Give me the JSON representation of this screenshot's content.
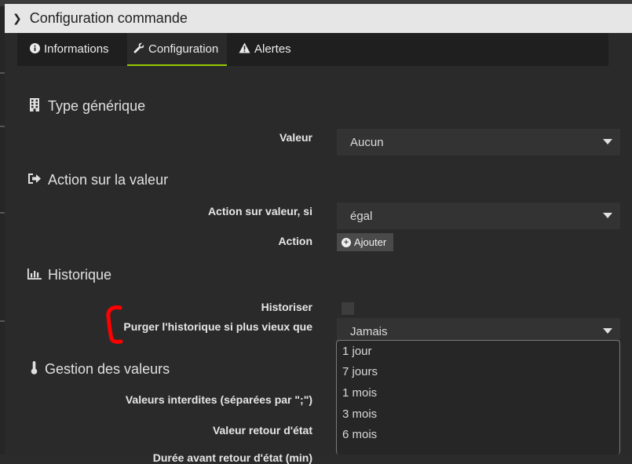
{
  "modal": {
    "title": "Configuration commande"
  },
  "tabs": [
    {
      "label": "Informations",
      "icon": "info-circle-icon"
    },
    {
      "label": "Configuration",
      "icon": "wrench-icon"
    },
    {
      "label": "Alertes",
      "icon": "warning-icon"
    }
  ],
  "sections": {
    "type": {
      "title": "Type générique",
      "icon": "building-icon"
    },
    "action": {
      "title": "Action sur la valeur",
      "icon": "sign-out-icon"
    },
    "history": {
      "title": "Historique",
      "icon": "bar-chart-icon"
    },
    "values": {
      "title": "Gestion des valeurs",
      "icon": "thermometer-icon"
    }
  },
  "fields": {
    "valeur_label": "Valeur",
    "valeur_value": "Aucun",
    "action_if_label": "Action sur valeur, si",
    "action_if_value": "égal",
    "action_label": "Action",
    "add_button": "Ajouter",
    "historiser_label": "Historiser",
    "purge_label": "Purger l'historique si plus vieux que",
    "purge_value": "Jamais",
    "forbidden_label": "Valeurs interdites (séparées par \";\")",
    "return_label": "Valeur retour d'état",
    "duration_label": "Durée avant retour d'état (min)"
  },
  "purge_options": [
    "1 jour",
    "7 jours",
    "1 mois",
    "3 mois",
    "6 mois"
  ],
  "colors": {
    "active_tab": "#94ca02",
    "annotation": "#ff0000"
  }
}
